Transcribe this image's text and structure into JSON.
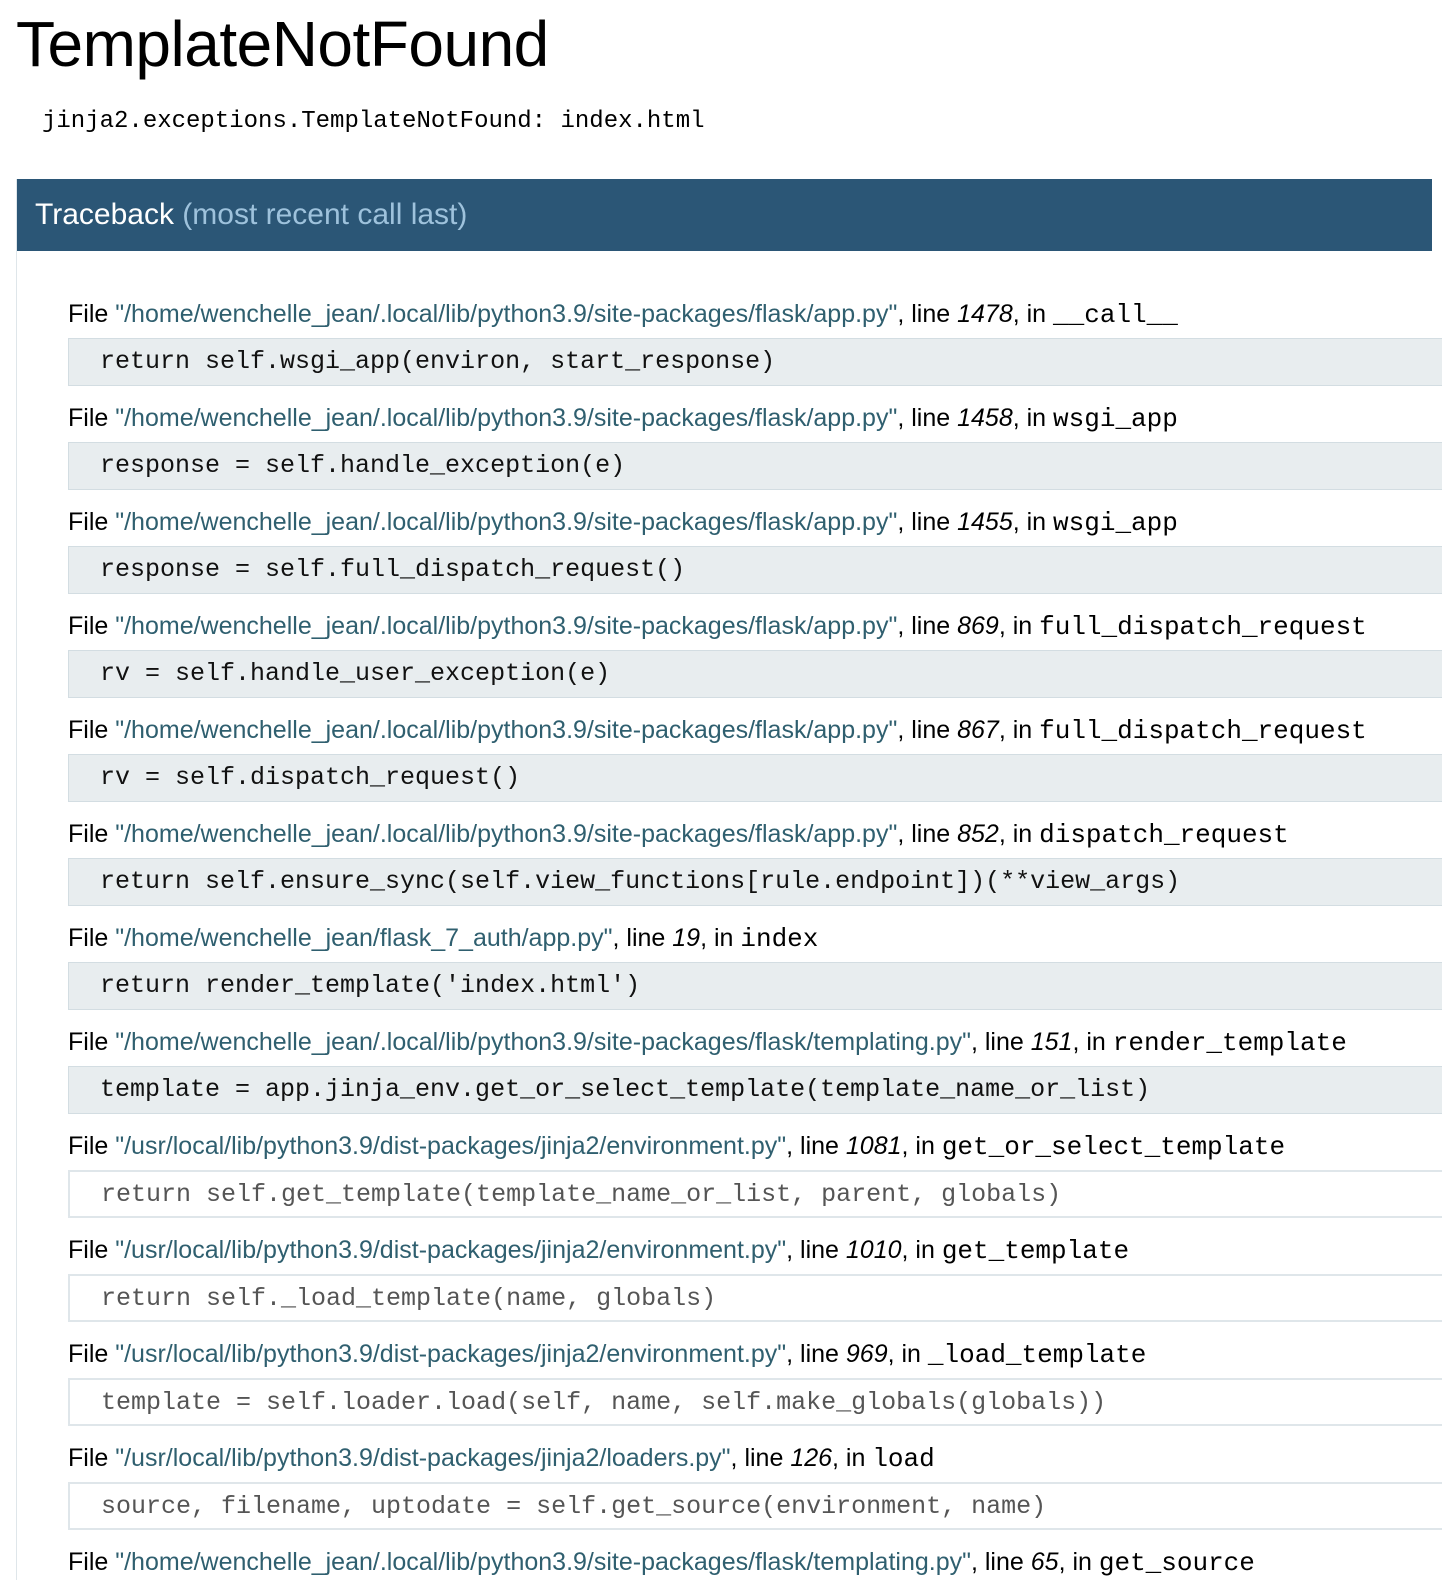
{
  "page": {
    "title": "TemplateNotFound",
    "error_message": "jinja2.exceptions.TemplateNotFound: index.html"
  },
  "traceback": {
    "heading": "Traceback",
    "subheading": "(most recent call last)",
    "labels": {
      "file": "File ",
      "line": ", line ",
      "in": ", in "
    },
    "frames": [
      {
        "filename": "\"/home/wenchelle_jean/.local/lib/python3.9/site-packages/flask/app.py\"",
        "lineno": "1478",
        "function": "__call__",
        "code": "return self.wsgi_app(environ, start_response)",
        "library": false
      },
      {
        "filename": "\"/home/wenchelle_jean/.local/lib/python3.9/site-packages/flask/app.py\"",
        "lineno": "1458",
        "function": "wsgi_app",
        "code": "response = self.handle_exception(e)",
        "library": false
      },
      {
        "filename": "\"/home/wenchelle_jean/.local/lib/python3.9/site-packages/flask/app.py\"",
        "lineno": "1455",
        "function": "wsgi_app",
        "code": "response = self.full_dispatch_request()",
        "library": false
      },
      {
        "filename": "\"/home/wenchelle_jean/.local/lib/python3.9/site-packages/flask/app.py\"",
        "lineno": "869",
        "function": "full_dispatch_request",
        "code": "rv = self.handle_user_exception(e)",
        "library": false
      },
      {
        "filename": "\"/home/wenchelle_jean/.local/lib/python3.9/site-packages/flask/app.py\"",
        "lineno": "867",
        "function": "full_dispatch_request",
        "code": "rv = self.dispatch_request()",
        "library": false
      },
      {
        "filename": "\"/home/wenchelle_jean/.local/lib/python3.9/site-packages/flask/app.py\"",
        "lineno": "852",
        "function": "dispatch_request",
        "code": "return self.ensure_sync(self.view_functions[rule.endpoint])(**view_args)",
        "library": false
      },
      {
        "filename": "\"/home/wenchelle_jean/flask_7_auth/app.py\"",
        "lineno": "19",
        "function": "index",
        "code": "return render_template('index.html')",
        "library": false
      },
      {
        "filename": "\"/home/wenchelle_jean/.local/lib/python3.9/site-packages/flask/templating.py\"",
        "lineno": "151",
        "function": "render_template",
        "code": "template = app.jinja_env.get_or_select_template(template_name_or_list)",
        "library": false
      },
      {
        "filename": "\"/usr/local/lib/python3.9/dist-packages/jinja2/environment.py\"",
        "lineno": "1081",
        "function": "get_or_select_template",
        "code": "return self.get_template(template_name_or_list, parent, globals)",
        "library": true
      },
      {
        "filename": "\"/usr/local/lib/python3.9/dist-packages/jinja2/environment.py\"",
        "lineno": "1010",
        "function": "get_template",
        "code": "return self._load_template(name, globals)",
        "library": true
      },
      {
        "filename": "\"/usr/local/lib/python3.9/dist-packages/jinja2/environment.py\"",
        "lineno": "969",
        "function": "_load_template",
        "code": "template = self.loader.load(self, name, self.make_globals(globals))",
        "library": true
      },
      {
        "filename": "\"/usr/local/lib/python3.9/dist-packages/jinja2/loaders.py\"",
        "lineno": "126",
        "function": "load",
        "code": "source, filename, uptodate = self.get_source(environment, name)",
        "library": true
      },
      {
        "filename": "\"/home/wenchelle_jean/.local/lib/python3.9/site-packages/flask/templating.py\"",
        "lineno": "65",
        "function": "get_source",
        "code": "",
        "library": false
      }
    ]
  },
  "colors": {
    "header_background": "#2b5676",
    "header_subtext": "#9ec2dc",
    "filename_text": "#2f5f6f",
    "app_code_background": "#e8edef",
    "library_code_background": "#ffffff"
  }
}
